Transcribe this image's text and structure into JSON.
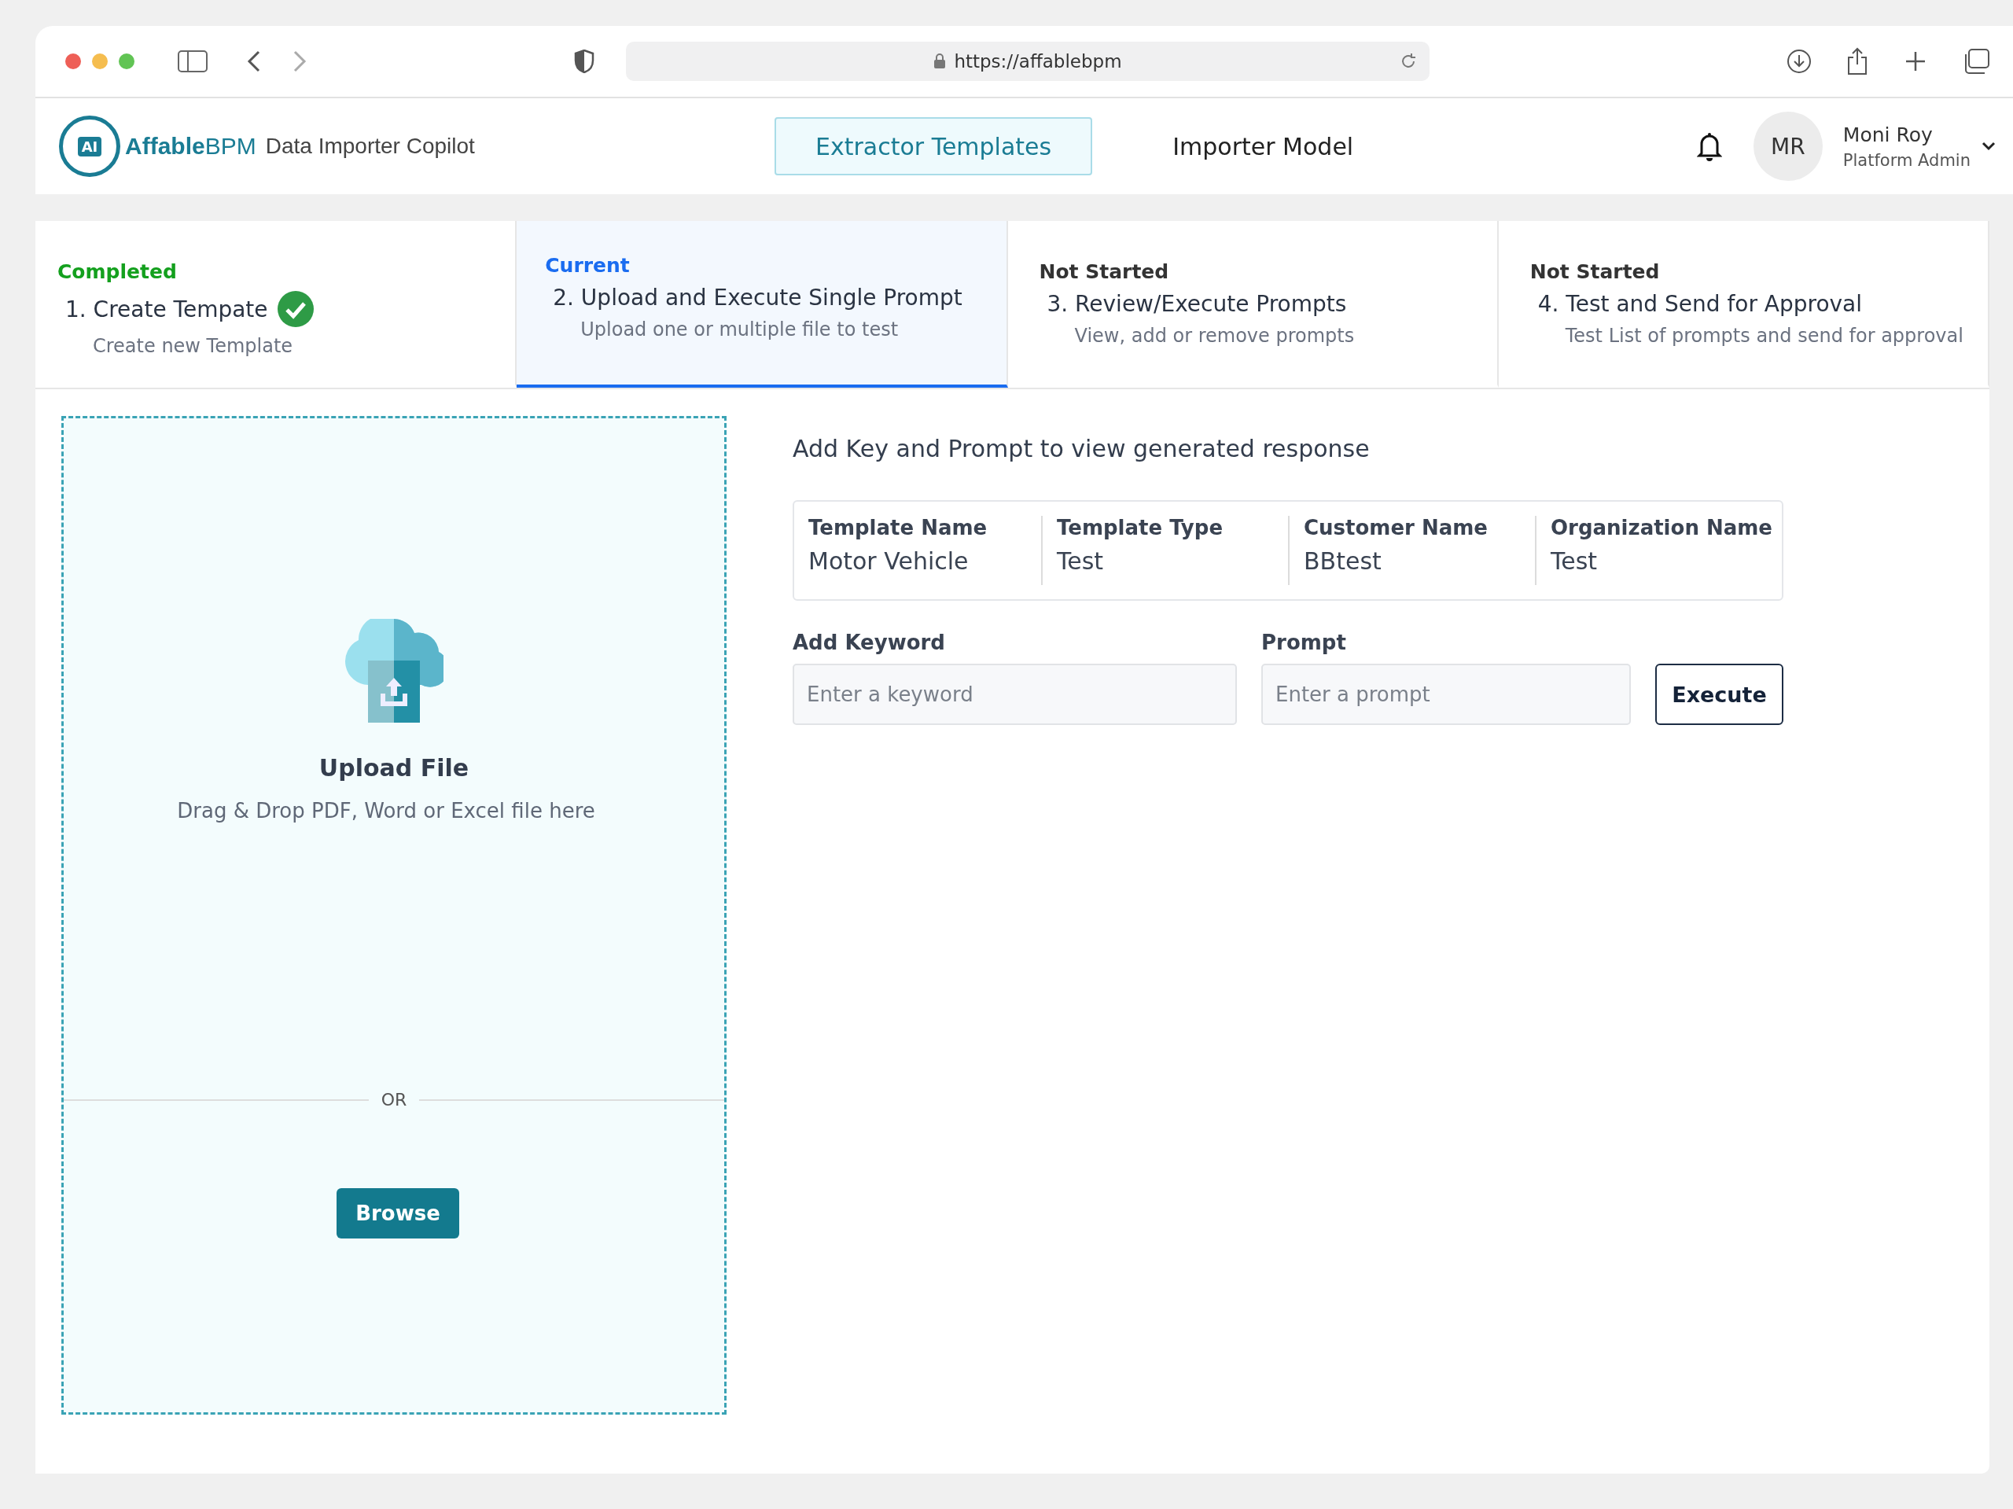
{
  "browser": {
    "url": "https://affablebpm"
  },
  "header": {
    "logo_badge": "AI",
    "brand": "**Affable**BPM",
    "product": "Data Importer Copilot",
    "nav": [
      {
        "label": "Extractor Templates",
        "selected": true
      },
      {
        "label": "Importer Model",
        "selected": false
      }
    ],
    "user": {
      "initials": "MR",
      "name": "Moni Roy",
      "role": "Platform Admin"
    }
  },
  "steps": [
    {
      "kind": "completed",
      "status": "Completed",
      "title": "1. Create Tempate",
      "subtitle": "Create new Template",
      "selected": false
    },
    {
      "kind": "current",
      "status": "Current",
      "title": "2. Upload and Execute Single Prompt",
      "subtitle": "Upload one or multiple file to test",
      "selected": true
    },
    {
      "kind": "not_started",
      "status": "Not Started",
      "title": "3. Review/Execute Prompts",
      "subtitle": "View, add or remove prompts",
      "selected": false
    },
    {
      "kind": "not_started",
      "status": "Not Started",
      "title": "4. Test and Send for Approval",
      "subtitle": "Test List of prompts and send for approval",
      "selected": false
    }
  ],
  "upload": {
    "title": "Upload File",
    "hint": "Drag & Drop PDF, Word or Excel file here",
    "divider": "OR",
    "button": "Browse"
  },
  "form": {
    "heading": "Add Key and Prompt to view generated response",
    "info": [
      {
        "label": "Template Name",
        "value": "Motor Vehicle"
      },
      {
        "label": "Template Type",
        "value": "Test"
      },
      {
        "label": "Customer Name",
        "value": "BBtest"
      },
      {
        "label": "Organization Name",
        "value": "Test"
      }
    ],
    "keyword": {
      "label": "Add Keyword",
      "placeholder": "Enter a keyword"
    },
    "prompt": {
      "label": "Prompt",
      "placeholder": "Enter a prompt"
    },
    "button": "Execute"
  }
}
